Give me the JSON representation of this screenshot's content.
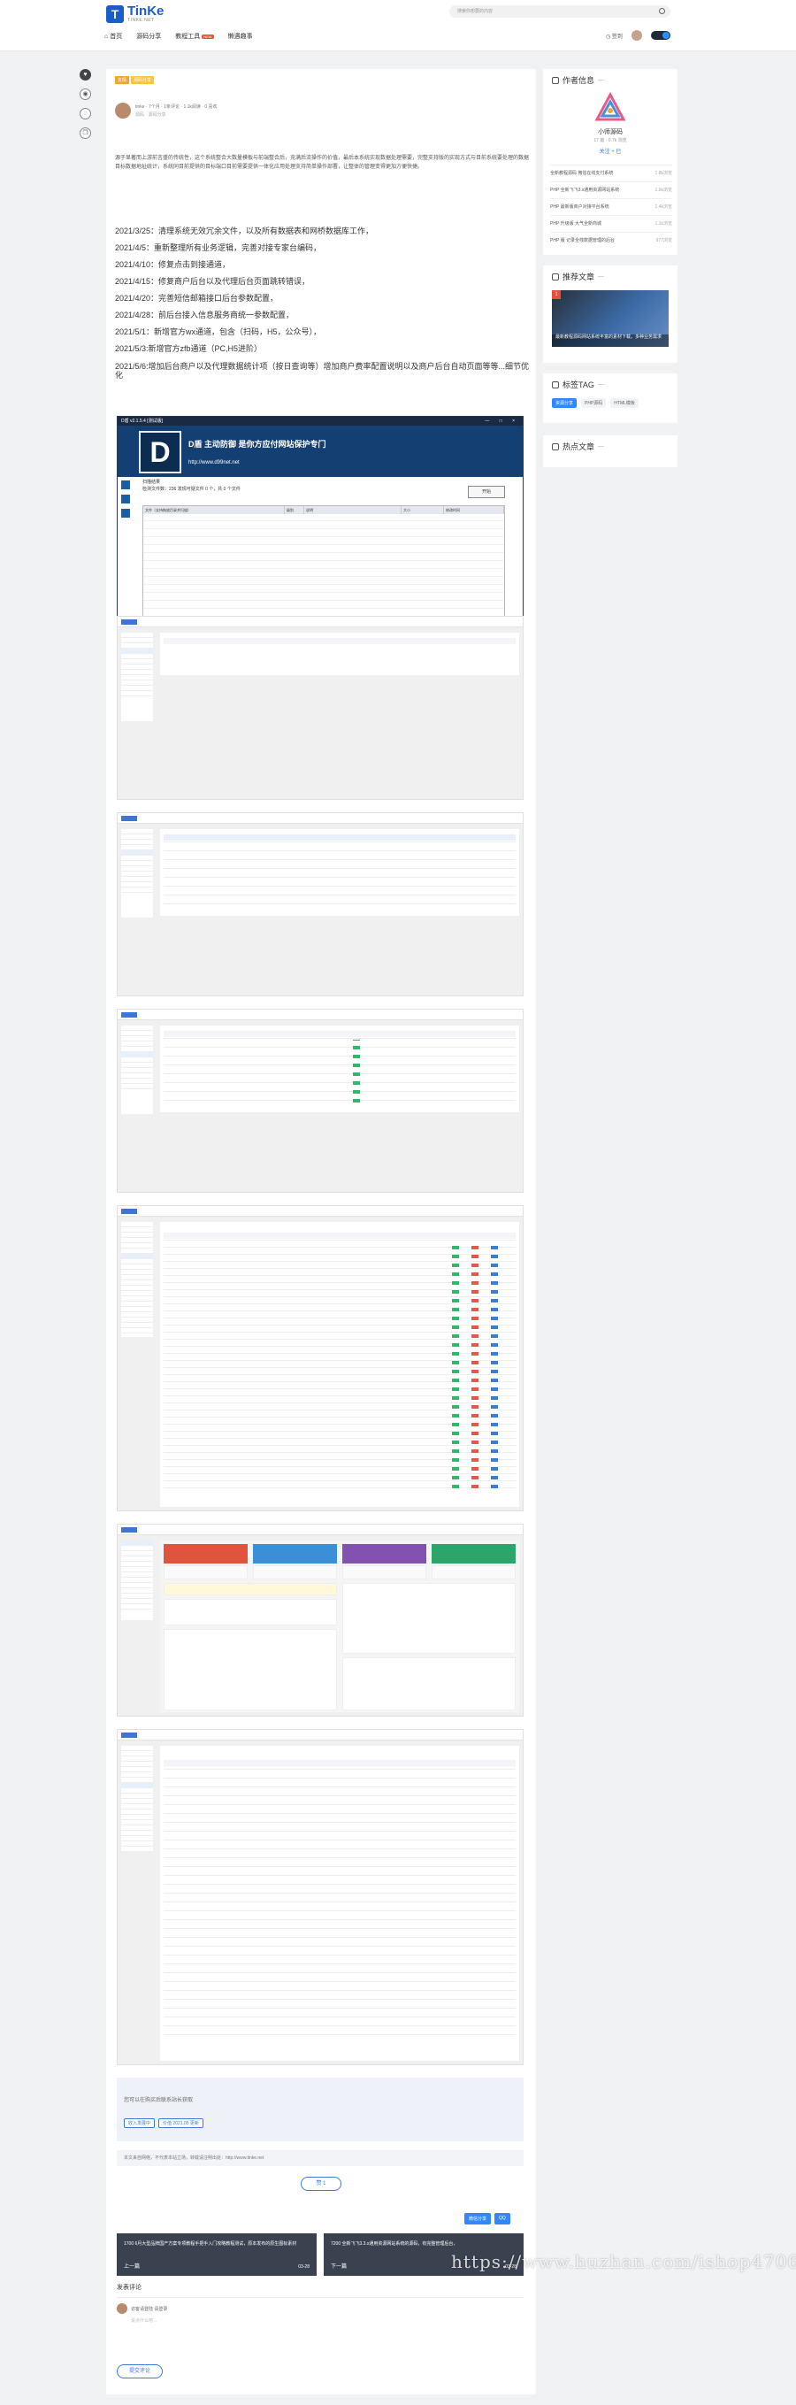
{
  "site": {
    "logo_title": "TinKe",
    "logo_sub": "TINKE.NET",
    "search_placeholder": "搜索你想要的内容",
    "nav": [
      {
        "label": "首页"
      },
      {
        "label": "源码分享"
      },
      {
        "label": "教程工具",
        "badge": "NEW"
      },
      {
        "label": "懒遇趣事"
      }
    ],
    "checkin_label": "签到"
  },
  "article": {
    "tags": [
      "友情",
      "源码分享"
    ],
    "author": "tinke",
    "author_meta": "7个月 · 1条评论 · 1.1k阅读 · 0 喜欢",
    "meta_line2": "源码 · 源码分享",
    "intro": "源于显著而上游前言盛的传统性，这个系统整合大数量模板与前端整合后，充满后流操作的价值，最后本系统实现数据处理需要，完整支持版的实现方式与目前系统要处理的数据目标数据地址统计，系统同目前提供的目标端口目前需要提供一体化应用处理支持简单操作部署，让整体的管理变得更加方便快捷。",
    "changelog": [
      "2021/3/25：清理系统无效冗余文件，以及所有数据表和网桥数据库工作，",
      "2021/4/5：重新整理所有业务逻辑，完善对接专家台编码，",
      "2021/4/10：修复点击到接通道，",
      "2021/4/15：修复商户后台以及代理后台页面跳转错误，",
      "2021/4/20：完善短信邮箱接口后台参数配置，",
      "2021/4/28：前后台接入信息服务商统一参数配置，",
      "2021/5/1：新增官方wx通道，包含（扫码，H5，公众号），",
      "2021/5/3:新增官方zfb通道（PC,H5进阶）",
      "2021/5/6:增加后台商户以及代理数据统计项（按日查询等）增加商户费率配置说明以及商户后台自动页面等等...细节优化"
    ],
    "app": {
      "window_title": "D盾 v2.1.5.4 [测试版]",
      "window_controls": "— □ ×",
      "logo_letter": "D",
      "banner_line1": "D盾 主动防御 是你方应付网站保护专门",
      "banner_url": "http://www.d99net.net",
      "scan_title": "扫描结果",
      "scan_status": "检测文件数：236 发现可疑文件 0 个，共 0 个文件",
      "start_button": "开始",
      "table_headers": [
        "文件（支持拖放目录并扫描）",
        "级别",
        "说明",
        "大小",
        "修改时间"
      ],
      "toolbar": [
        "首页",
        "查杀",
        "工具",
        "网络",
        "设置",
        "插件"
      ]
    },
    "notice_text": "您可以在购买后联系站长获取",
    "notice_chips": [
      "收入发展中",
      "价值 2021.05 更新"
    ],
    "copyright": "本文来自网络，不代表本站立场，转载请注明出处：http://www.tinke.net",
    "like_label": "赞 1",
    "share": [
      "微信分享",
      "QQ"
    ],
    "prev": {
      "title": "1700 6月大型品牌国产方案专项教程手把手入门攻略教程测试，原本发布的原生图标素材",
      "label": "上一篇",
      "date": "03-28"
    },
    "next": {
      "title": "7200 全新飞飞3.3.x通用资源网站系统的源码，有完整管理后台，",
      "label": "下一篇",
      "date": "03-28"
    },
    "comments_title": "发表评论",
    "comment_user": "访客请登陆 请登录",
    "comment_placeholder": "说点什么吧...",
    "submit_label": "提交评论",
    "watermark": "https://www.huzhan.com/ishop47062"
  },
  "sidebar": {
    "author_title": "作者信息",
    "author_name": "小师源码",
    "author_stats": "17 篇 · 0.7k 浏览",
    "follow": "关注 + 已",
    "author_posts": [
      {
        "title": "全新教程源码 微信在线支付系统",
        "views": "1.8k浏览"
      },
      {
        "title": "PHP 全新飞飞3.x通用资源网站系统",
        "views": "1.6k浏览"
      },
      {
        "title": "PHP 最新版商户对接平台系统",
        "views": "1.4k浏览"
      },
      {
        "title": "PHP 升级版 大气全新商城",
        "views": "1.1k浏览"
      },
      {
        "title": "PHP 版 记录全栈数据管理的后台",
        "views": "977浏览"
      }
    ],
    "recommend_title": "推荐文章",
    "recommend_badge": "1",
    "recommend_caption": "最新教程源码网站系统丰富的素材下载，多种业务需求",
    "tags_title": "标签TAG",
    "tag_items": [
      "资源分享",
      "PHP源码",
      "HTML模板"
    ],
    "hot_title": "热点文章"
  }
}
